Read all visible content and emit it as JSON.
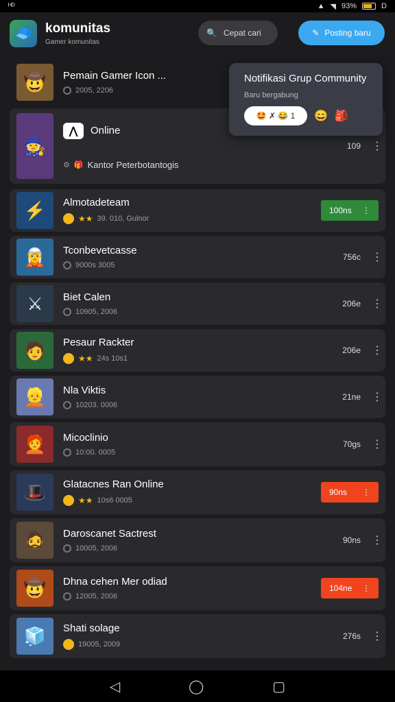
{
  "status_bar": {
    "left_icon": "ᴴᴰ",
    "battery_text": "93%",
    "battery_label": "D"
  },
  "header": {
    "title": "komunitas",
    "subtitle": "Gamer komunitas",
    "search_label": "Cepat cari",
    "action_label": "Posting baru"
  },
  "popup": {
    "title": "Notifikasi Grup Community",
    "subtitle": "Baru bergabung",
    "pill_text": "🤩 ✗ 😂 1",
    "emoji_1": "😄",
    "emoji_2": "🎒"
  },
  "list": [
    {
      "name": "Pemain Gamer Icon ...",
      "meta": "2005, 2206",
      "count": "",
      "pill": "",
      "type": "header"
    },
    {
      "name": "Online",
      "meta": "Kantor Peterbotantogis",
      "count": "109",
      "pill": "",
      "type": "online"
    },
    {
      "name": "Almotadeteam",
      "meta": "39. 010, Gulnor",
      "count": "",
      "pill": "100ns",
      "pill_color": "green",
      "type": "coin"
    },
    {
      "name": "Tconbevetcasse",
      "meta": "9000s 3005",
      "count": "756c",
      "pill": "",
      "type": "clock"
    },
    {
      "name": "Biet Calen",
      "meta": "10905, 2006",
      "count": "206e",
      "pill": "",
      "type": "clock"
    },
    {
      "name": "Pesaur Rackter",
      "meta": "24s 10s1",
      "count": "206e",
      "pill": "",
      "type": "coin"
    },
    {
      "name": "Nla Viktis",
      "meta": "10203. 0006",
      "count": "21ne",
      "pill": "",
      "type": "clock"
    },
    {
      "name": "Micoclinio",
      "meta": "10:00. 0005",
      "count": "70gs",
      "pill": "",
      "type": "clock"
    },
    {
      "name": "Glatacnes Ran Online",
      "meta": "10s6 0005",
      "count": "",
      "pill": "90ns",
      "pill_color": "red",
      "type": "coin"
    },
    {
      "name": "Daroscanet Sactrest",
      "meta": "10005, 2006",
      "count": "90ns",
      "pill": "",
      "type": "clock"
    },
    {
      "name": "Dhna cehen Mer odiad",
      "meta": "12005, 2006",
      "count": "",
      "pill": "104ne",
      "pill_color": "red",
      "type": "clock"
    },
    {
      "name": "Shati solage",
      "meta": "19005, 2009",
      "count": "276s",
      "pill": "",
      "type": "coin"
    }
  ],
  "nav": {
    "back": "◁",
    "home": "◯",
    "recent": "▢"
  }
}
